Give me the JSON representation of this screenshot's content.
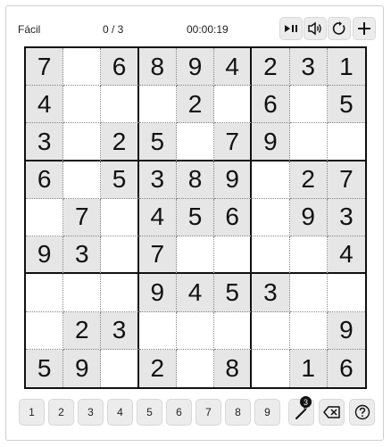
{
  "header": {
    "difficulty": "Fácil",
    "progress": "0 / 3",
    "timer": "00:00:19"
  },
  "controls": {
    "icons": [
      "play-pause-icon",
      "speaker-icon",
      "restart-icon",
      "plus-icon"
    ]
  },
  "board": {
    "rows": [
      [
        "7",
        "",
        "6",
        "8",
        "9",
        "4",
        "2",
        "3",
        "1"
      ],
      [
        "4",
        "",
        "",
        "",
        "2",
        "",
        "6",
        "",
        "5"
      ],
      [
        "3",
        "",
        "2",
        "5",
        "",
        "7",
        "9",
        "",
        ""
      ],
      [
        "6",
        "",
        "5",
        "3",
        "8",
        "9",
        "",
        "2",
        "7"
      ],
      [
        "",
        "7",
        "",
        "4",
        "5",
        "6",
        "",
        "9",
        "3"
      ],
      [
        "9",
        "3",
        "",
        "7",
        "",
        "",
        "",
        "",
        "4"
      ],
      [
        "",
        "",
        "",
        "9",
        "4",
        "5",
        "3",
        "",
        ""
      ],
      [
        "",
        "2",
        "3",
        "",
        "",
        "",
        "",
        "",
        "9"
      ],
      [
        "5",
        "9",
        "",
        "2",
        "",
        "8",
        "",
        "1",
        "6"
      ]
    ],
    "given_color": "#e6e6e6"
  },
  "numpad": {
    "keys": [
      "1",
      "2",
      "3",
      "4",
      "5",
      "6",
      "7",
      "8",
      "9"
    ],
    "hint_count": "3",
    "tool_icons": [
      "magic-wand-hint-icon",
      "erase-icon",
      "help-icon"
    ]
  }
}
